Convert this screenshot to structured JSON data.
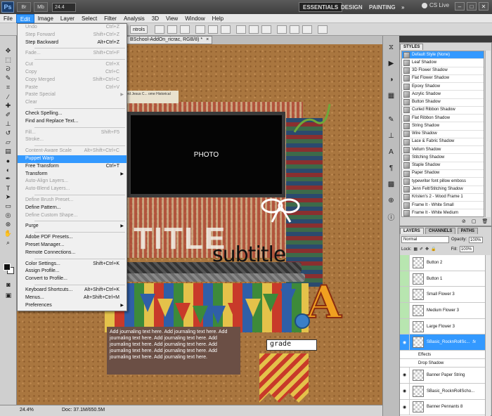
{
  "app": {
    "logo": "Ps",
    "bar_buttons": [
      "Br",
      "Mb"
    ],
    "zoom_field": "24.4",
    "workspaces": [
      {
        "label": "ESSENTIALS",
        "active": true
      },
      {
        "label": "DESIGN",
        "active": false
      },
      {
        "label": "PAINTING",
        "active": false
      }
    ],
    "overflow": "»",
    "cs_live": "CS Live",
    "window_controls": [
      "–",
      "□",
      "✕"
    ]
  },
  "menubar": [
    "File",
    "Edit",
    "Image",
    "Layer",
    "Select",
    "Filter",
    "Analysis",
    "3D",
    "View",
    "Window",
    "Help"
  ],
  "optionsbar": {
    "partial_label": "ntrols"
  },
  "document_tab": {
    "title": "BSchool-AddOn_ricrac, RGB/8) *",
    "close": "×"
  },
  "edit_menu": {
    "groups": [
      [
        {
          "label": "Undo",
          "shortcut": "Ctrl+Z",
          "disabled": true
        },
        {
          "label": "Step Forward",
          "shortcut": "Shift+Ctrl+Z",
          "disabled": true
        },
        {
          "label": "Step Backward",
          "shortcut": "Alt+Ctrl+Z",
          "disabled": false
        }
      ],
      [
        {
          "label": "Fade...",
          "shortcut": "Shift+Ctrl+F",
          "disabled": true
        }
      ],
      [
        {
          "label": "Cut",
          "shortcut": "Ctrl+X",
          "disabled": true
        },
        {
          "label": "Copy",
          "shortcut": "Ctrl+C",
          "disabled": true
        },
        {
          "label": "Copy Merged",
          "shortcut": "Shift+Ctrl+C",
          "disabled": true
        },
        {
          "label": "Paste",
          "shortcut": "Ctrl+V",
          "disabled": true
        },
        {
          "label": "Paste Special",
          "shortcut": "",
          "disabled": true,
          "submenu": true
        },
        {
          "label": "Clear",
          "shortcut": "",
          "disabled": true
        }
      ],
      [
        {
          "label": "Check Spelling...",
          "shortcut": "",
          "disabled": false
        },
        {
          "label": "Find and Replace Text...",
          "shortcut": "",
          "disabled": false
        }
      ],
      [
        {
          "label": "Fill...",
          "shortcut": "Shift+F5",
          "disabled": true
        },
        {
          "label": "Stroke...",
          "shortcut": "",
          "disabled": true
        }
      ],
      [
        {
          "label": "Content-Aware Scale",
          "shortcut": "Alt+Shift+Ctrl+C",
          "disabled": true
        },
        {
          "label": "Puppet Warp",
          "shortcut": "",
          "disabled": false,
          "highlighted": true
        },
        {
          "label": "Free Transform",
          "shortcut": "Ctrl+T",
          "disabled": false
        },
        {
          "label": "Transform",
          "shortcut": "",
          "disabled": false,
          "submenu": true
        },
        {
          "label": "Auto-Align Layers...",
          "shortcut": "",
          "disabled": true
        },
        {
          "label": "Auto-Blend Layers...",
          "shortcut": "",
          "disabled": true
        }
      ],
      [
        {
          "label": "Define Brush Preset...",
          "shortcut": "",
          "disabled": true
        },
        {
          "label": "Define Pattern...",
          "shortcut": "",
          "disabled": false
        },
        {
          "label": "Define Custom Shape...",
          "shortcut": "",
          "disabled": true
        }
      ],
      [
        {
          "label": "Purge",
          "shortcut": "",
          "disabled": false,
          "submenu": true
        }
      ],
      [
        {
          "label": "Adobe PDF Presets...",
          "shortcut": "",
          "disabled": false
        },
        {
          "label": "Preset Manager...",
          "shortcut": "",
          "disabled": false
        },
        {
          "label": "Remote Connections...",
          "shortcut": "",
          "disabled": false
        }
      ],
      [
        {
          "label": "Color Settings...",
          "shortcut": "Shift+Ctrl+K",
          "disabled": false
        },
        {
          "label": "Assign Profile...",
          "shortcut": "",
          "disabled": false
        },
        {
          "label": "Convert to Profile...",
          "shortcut": "",
          "disabled": false
        }
      ],
      [
        {
          "label": "Keyboard Shortcuts...",
          "shortcut": "Alt+Shift+Ctrl+K",
          "disabled": false
        },
        {
          "label": "Menus...",
          "shortcut": "Alt+Shift+Ctrl+M",
          "disabled": false
        },
        {
          "label": "Preferences",
          "shortcut": "",
          "disabled": false,
          "submenu": true
        }
      ]
    ]
  },
  "canvas": {
    "photo_label": "PHOTO",
    "subtitle": "subtitle",
    "title_word": "TITLE",
    "label_chip": "Lord Jesus C... ome Historical",
    "journal_text": "Add journaling text here. Add journaling text here. Add journaling text here. Add journaling text here. Add journaling text here. Add journaling text here. Add journaling text here. Add journaling text here. Add journaling text here. Add journaling text here.",
    "grade_label": "grade",
    "big_letter": "A"
  },
  "statusbar": {
    "zoom": "24.4%",
    "doc_info": "Doc: 37.1M/650.5M"
  },
  "styles_panel": {
    "tab": "STYLES",
    "items": [
      {
        "label": "Default Style (None)",
        "selected": true
      },
      {
        "label": "Leaf Shadow"
      },
      {
        "label": "3D Flower Shadow"
      },
      {
        "label": "Flat Flower Shadow"
      },
      {
        "label": "Epoxy Shadow"
      },
      {
        "label": "Acrylic Shadow"
      },
      {
        "label": "Button Shadow"
      },
      {
        "label": "Curled Ribbon Shadow"
      },
      {
        "label": "Flat Ribbon Shadow"
      },
      {
        "label": "String Shadow"
      },
      {
        "label": "Wire Shadow"
      },
      {
        "label": "Lace & Fabric Shadow"
      },
      {
        "label": "Vellum Shadow"
      },
      {
        "label": "Stitching Shadow"
      },
      {
        "label": "Staple Shadow"
      },
      {
        "label": "Paper Shadow"
      },
      {
        "label": "typewriter font pillow emboss"
      },
      {
        "label": "Jenn Felt/Stitching Shadow"
      },
      {
        "label": "Kristen's 2 - Wood Frame 1"
      },
      {
        "label": "Frame It - White Small"
      },
      {
        "label": "Frame It - White Medium"
      }
    ]
  },
  "layers_panel": {
    "tabs": [
      "LAYERS",
      "CHANNELS",
      "PATHS"
    ],
    "blend_mode": "Normal",
    "opacity_label": "Opacity:",
    "opacity": "100%",
    "lock_label": "Lock:",
    "fill_label": "Fill:",
    "fill": "100%",
    "layers": [
      {
        "label": "Button 2",
        "green": true
      },
      {
        "label": "Button 1",
        "green": true
      },
      {
        "label": "Small Flower 3",
        "green": true
      },
      {
        "label": "Medium Flower 3",
        "green": true
      },
      {
        "label": "Large Flower 3",
        "green": true
      },
      {
        "label": "SBasic_RocknRollSc...",
        "selected": true,
        "fx": "fx"
      },
      {
        "label": "Effects",
        "sub": true
      },
      {
        "label": "Drop Shadow",
        "sub": true
      },
      {
        "label": "Banner Paper String"
      },
      {
        "label": "SBasic_RocknRollScho..."
      },
      {
        "label": "Banner Pennants 8"
      }
    ]
  }
}
